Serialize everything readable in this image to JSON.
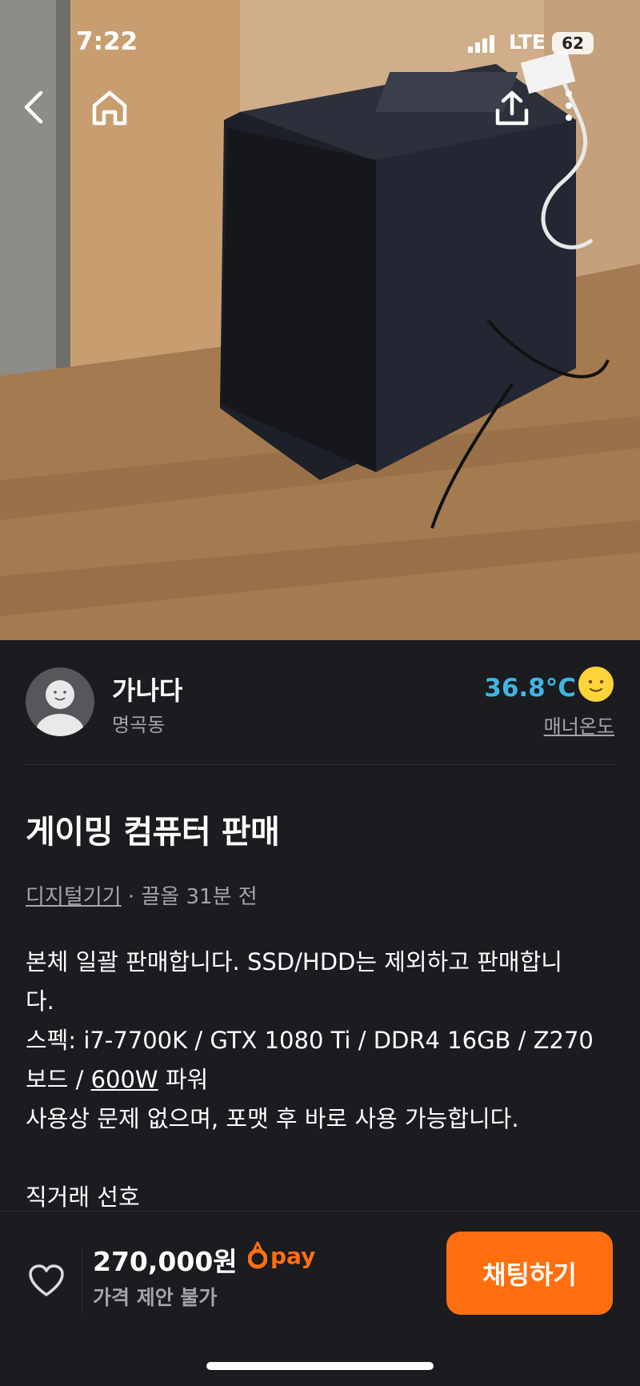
{
  "status_bar": {
    "time": "7:22",
    "network": "LTE",
    "battery": "62"
  },
  "nav": {
    "back_icon": "chevron-left-icon",
    "home_icon": "home-icon",
    "share_icon": "share-icon",
    "more_icon": "more-vertical-icon"
  },
  "seller": {
    "name": "가나다",
    "location": "명곡동",
    "temperature": "36.8°C",
    "manner_label": "매너온도",
    "temperature_color": "#3fb6e3"
  },
  "post": {
    "title": "게이밍 컴퓨터 판매",
    "category": "디지털기기",
    "separator": " · ",
    "bump_time": "끌올 31분 전",
    "description": {
      "line1": "본체 일괄 판매합니다. SSD/HDD는 제외하고 판매합니",
      "line2": "다.",
      "line3": "스펙: i7-7700K / GTX 1080 Ti / DDR4 16GB / Z270",
      "line4_prefix": "보드 / ",
      "line4_link": "600W",
      "line4_suffix": " 파워",
      "line5": "사용상 문제 없으며, 포맷 후 바로 사용 가능합니다.",
      "line6": "",
      "line7": "직거래 선호"
    }
  },
  "bottom_bar": {
    "price": "270,000원",
    "pay_label": "pay",
    "price_offer": "가격 제안 불가",
    "chat_button": "채팅하기",
    "accent_color": "#ff6f0f"
  }
}
